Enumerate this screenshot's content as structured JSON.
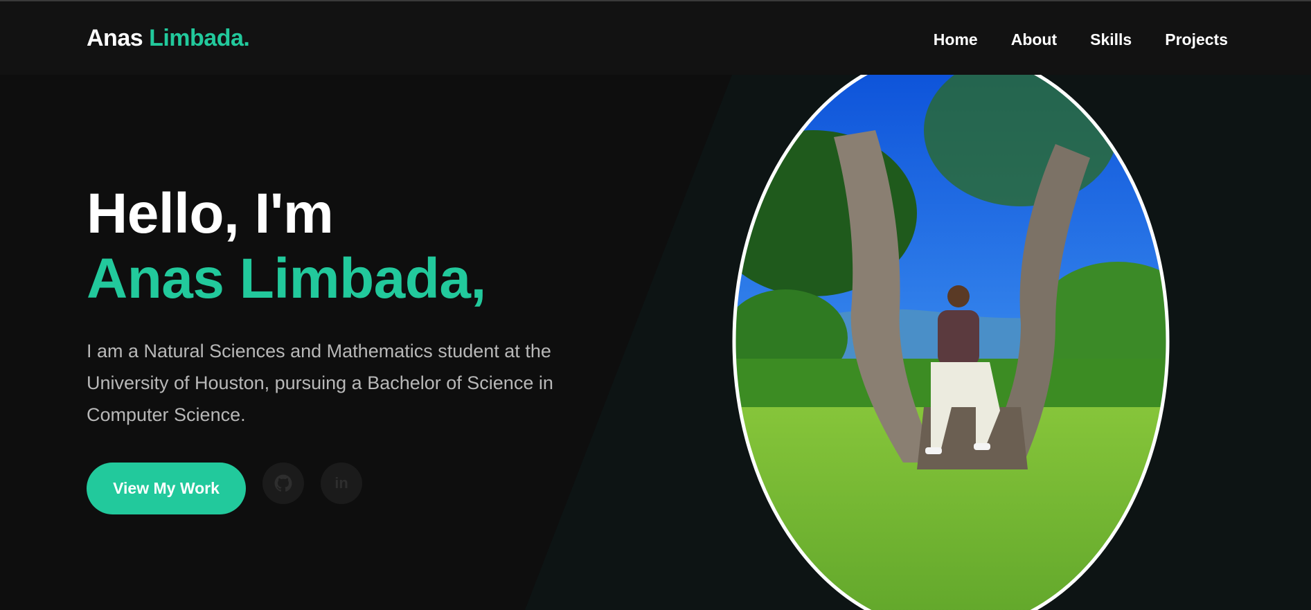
{
  "navbar": {
    "logo_first": "Anas",
    "logo_accent": "Limbada.",
    "links": [
      "Home",
      "About",
      "Skills",
      "Projects"
    ]
  },
  "hero": {
    "greeting": "Hello, I'm",
    "name": "Anas Limbada,",
    "bio": "I am a Natural Sciences and Mathematics student at the University of Houston, pursuing a Bachelor of Science in Computer Science.",
    "cta_label": "View My Work",
    "social_icons": [
      "github-icon",
      "linkedin-icon"
    ],
    "linkedin_glyph": "in",
    "photo_icon": "profile-photo"
  },
  "colors": {
    "accent": "#22c99c",
    "background": "#0e0e0e",
    "navbar": "#121212",
    "panel": "#0d1414",
    "text_muted": "#b8b8b8"
  }
}
